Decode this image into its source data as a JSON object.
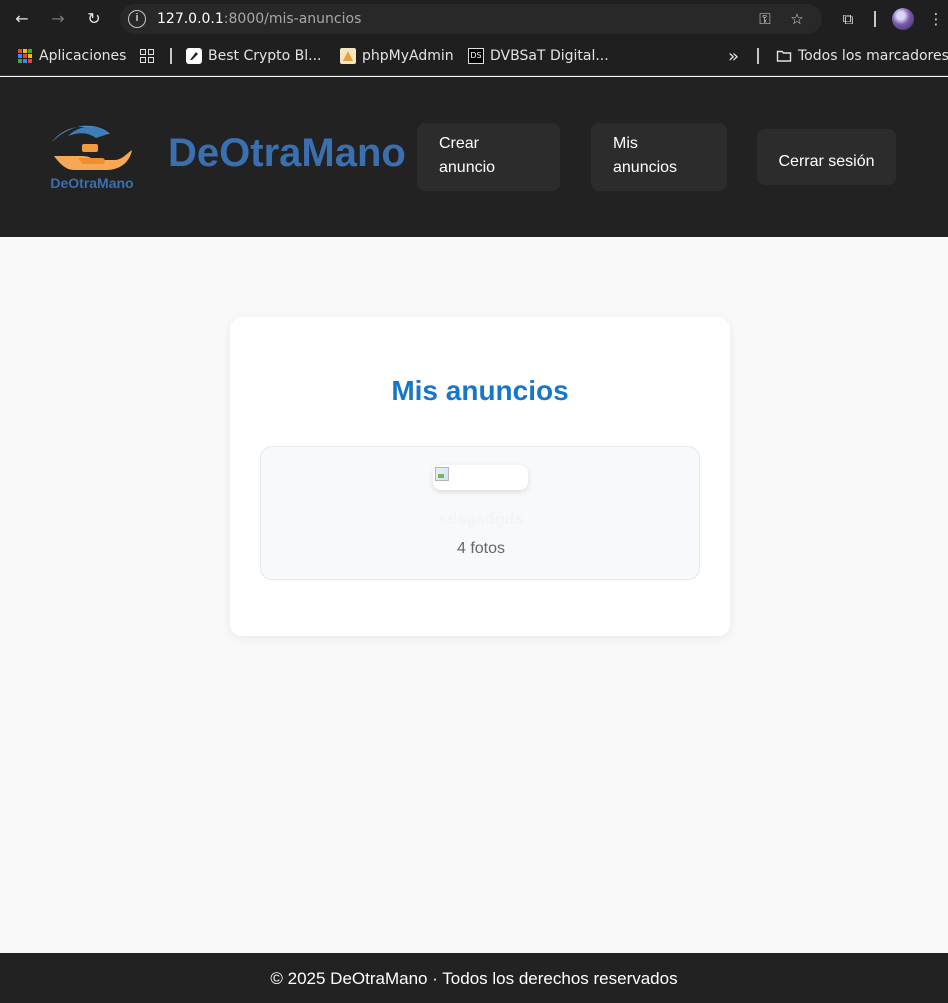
{
  "browser": {
    "url_host": "127.0.0.1",
    "url_rest": ":8000/mis-anuncios",
    "bookmarks": [
      {
        "label": "Aplicaciones"
      },
      {
        "label": "Best Crypto Bl..."
      },
      {
        "label": "phpMyAdmin"
      },
      {
        "label": "DVBSaT Digital..."
      }
    ],
    "more_bookmarks": "»",
    "all_bookmarks": "Todos los marcadores"
  },
  "header": {
    "logo_text": "DeOtraMano",
    "brand": "DeOtraMano",
    "nav": {
      "crear": "Crear anuncio",
      "mis": "Mis anuncios",
      "logout": "Cerrar sesión"
    }
  },
  "main": {
    "title": "Mis anuncios",
    "ads": [
      {
        "title": "sdsgsdgds",
        "photos": "4 fotos"
      }
    ]
  },
  "footer": {
    "text": "© 2025 DeOtraMano · Todos los derechos reservados"
  },
  "colors": {
    "brand": "#3a6fb0",
    "title": "#1876c9",
    "header_bg": "#222222",
    "page_bg": "#f9f9f9"
  }
}
